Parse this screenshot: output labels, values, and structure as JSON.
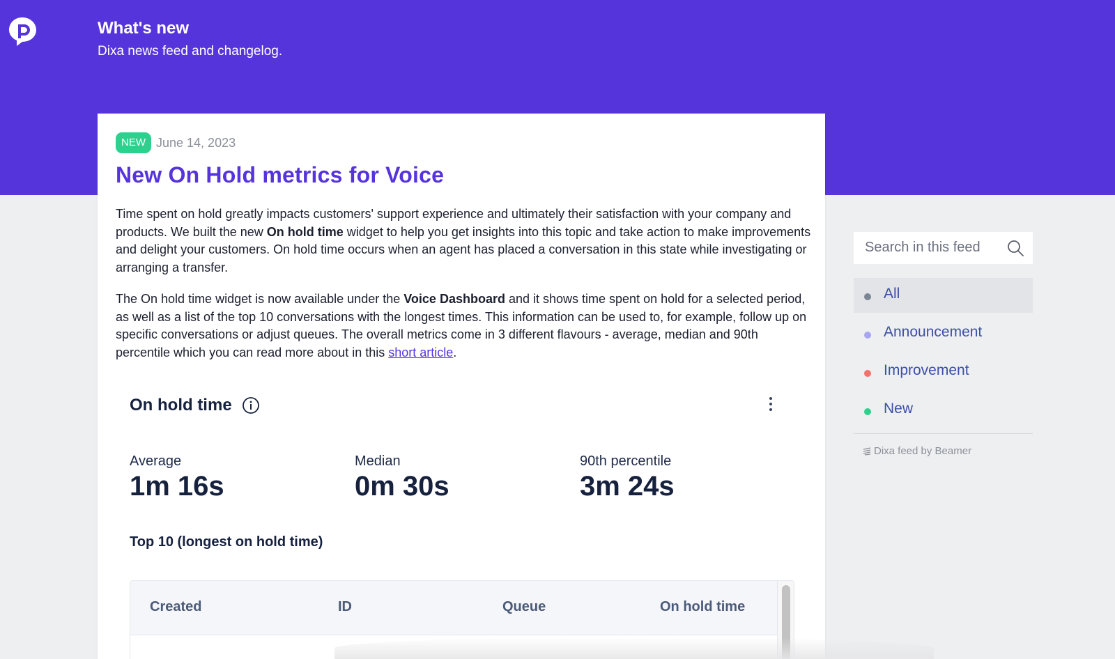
{
  "header": {
    "title": "What's new",
    "subtitle": "Dixa news feed and changelog."
  },
  "post": {
    "badge": "NEW",
    "date": "June 14, 2023",
    "title": "New On Hold metrics for Voice",
    "p1": {
      "a": "Time spent on hold greatly impacts customers' support experience and ultimately their satisfaction with your company and products. We built the new ",
      "bold": "On hold time",
      "b": " widget to help you get insights into this topic and take action to make improvements and delight your customers. On hold time occurs when an agent has placed a conversation in this state while investigating or arranging a transfer."
    },
    "p2": {
      "a": "The On hold time widget is now available under the ",
      "bold": "Voice Dashboard",
      "b": " and it shows time spent on hold for a selected period, as well as a list of the top 10 conversations with the longest times. This information can be used to, for example, follow up on specific conversations or adjust queues. The overall metrics come in 3 different flavours - average, median and 90th percentile which you can read more about in this ",
      "link": "short article",
      "c": "."
    }
  },
  "widget": {
    "title": "On hold time",
    "metrics": [
      {
        "label": "Average",
        "value": "1m 16s"
      },
      {
        "label": "Median",
        "value": "0m 30s"
      },
      {
        "label": "90th percentile",
        "value": "3m 24s"
      }
    ],
    "top10_title": "Top 10 (longest on hold time)",
    "columns": [
      "Created",
      "ID",
      "Queue",
      "On hold time"
    ]
  },
  "sidebar": {
    "search_placeholder": "Search in this feed",
    "filters": [
      {
        "label": "All",
        "color": "#7b8593",
        "active": true
      },
      {
        "label": "Announcement",
        "color": "#a8a6f0",
        "active": false
      },
      {
        "label": "Improvement",
        "color": "#f0726a",
        "active": false
      },
      {
        "label": "New",
        "color": "#2ed08e",
        "active": false
      }
    ],
    "powered_by": "Dixa feed by Beamer"
  },
  "colors": {
    "brand": "#5634db",
    "new_badge": "#2ed08e"
  }
}
